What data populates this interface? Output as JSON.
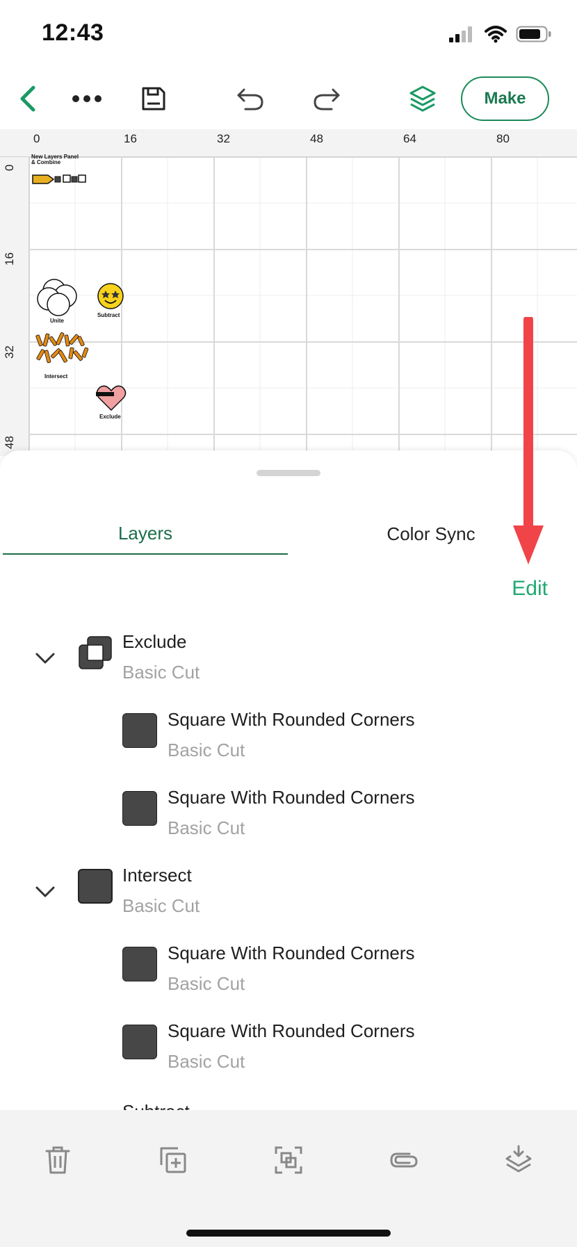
{
  "status_bar": {
    "time": "12:43"
  },
  "toolbar": {
    "make_label": "Make"
  },
  "ruler": {
    "top_labels": [
      "0",
      "16",
      "32",
      "48",
      "64",
      "80"
    ],
    "left_labels": [
      "0",
      "16",
      "32",
      "48"
    ]
  },
  "canvas_objects": {
    "panel_title": "New Layers Panel\n& Combine",
    "unite_label": "Unite",
    "subtract_label": "Subtract",
    "intersect_label": "Intersect",
    "exclude_label": "Exclude"
  },
  "panel": {
    "tabs": [
      {
        "label": "Layers",
        "active": true
      },
      {
        "label": "Color Sync",
        "active": false
      }
    ],
    "edit_label": "Edit",
    "layers": [
      {
        "name": "Exclude",
        "subtitle": "Basic Cut",
        "group": true
      },
      {
        "name": "Square With Rounded Corners",
        "subtitle": "Basic Cut",
        "group": false
      },
      {
        "name": "Square With Rounded Corners",
        "subtitle": "Basic Cut",
        "group": false
      },
      {
        "name": "Intersect",
        "subtitle": "Basic Cut",
        "group": true
      },
      {
        "name": "Square With Rounded Corners",
        "subtitle": "Basic Cut",
        "group": false
      },
      {
        "name": "Square With Rounded Corners",
        "subtitle": "Basic Cut",
        "group": false
      }
    ],
    "partial_layer_name": "Subtract"
  },
  "colors": {
    "accent": "#1b8a5a",
    "edit": "#1fa872",
    "annotation_arrow": "#f04448"
  },
  "icons": {
    "toolbar": [
      "back-chevron-icon",
      "more-dots-icon",
      "save-icon",
      "undo-icon",
      "redo-icon",
      "layers-icon"
    ],
    "bottom_bar": [
      "delete-icon",
      "duplicate-icon",
      "group-icon",
      "attach-icon",
      "flatten-icon"
    ]
  }
}
